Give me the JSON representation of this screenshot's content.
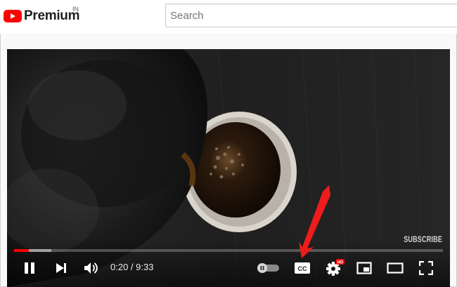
{
  "header": {
    "logo_text": "Premium",
    "region_label": "IN",
    "search": {
      "placeholder": "Search",
      "value": ""
    }
  },
  "player": {
    "watermark": "SUBSCRIBE",
    "time_current": "0:20",
    "time_separator": " / ",
    "time_total": "9:33",
    "progress_fraction": 0.035,
    "buffered_fraction": 0.087,
    "autoplay": "off",
    "hd_badge": "HD",
    "cc_label": "CC"
  },
  "colors": {
    "brand_red": "#ff0000",
    "annotation_arrow": "#ee1c1c"
  },
  "icons": [
    "youtube-logo-icon",
    "pause-icon",
    "next-icon",
    "volume-icon",
    "autoplay-toggle-icon",
    "captions-icon",
    "settings-icon",
    "miniplayer-icon",
    "theater-mode-icon",
    "fullscreen-icon"
  ]
}
